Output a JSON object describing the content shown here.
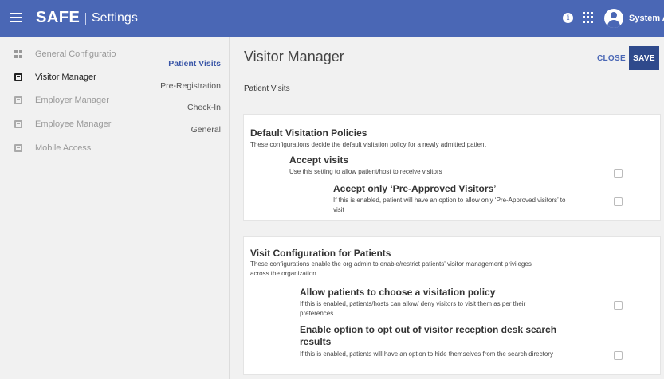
{
  "header": {
    "brand": "SAFE",
    "subtitle": "Settings",
    "user": "System A"
  },
  "sidebar": {
    "items": [
      {
        "label": "General Configuration",
        "icon": "dashboard-icon",
        "active": false
      },
      {
        "label": "Visitor Manager",
        "icon": "book-icon",
        "active": true
      },
      {
        "label": "Employer Manager",
        "icon": "book-icon",
        "active": false
      },
      {
        "label": "Employee Manager",
        "icon": "book-icon",
        "active": false
      },
      {
        "label": "Mobile Access",
        "icon": "book-icon",
        "active": false
      }
    ]
  },
  "subnav": {
    "items": [
      {
        "label": "Patient Visits",
        "active": true
      },
      {
        "label": "Pre-Registration",
        "active": false
      },
      {
        "label": "Check-In",
        "active": false
      },
      {
        "label": "General",
        "active": false
      }
    ]
  },
  "main": {
    "title": "Visitor Manager",
    "close_label": "CLOSE",
    "save_label": "SAVE",
    "section_label": "Patient Visits",
    "cards": [
      {
        "title": "Default Visitation Policies",
        "description": "These configurations decide the default visitation policy for a newly admitted patient",
        "options": [
          {
            "title": "Accept visits",
            "description": "Use this setting to allow patient/host to receive visitors",
            "checked": false
          },
          {
            "title": "Accept only ‘Pre-Approved Visitors’",
            "description": "If this is enabled, patient will have an option to allow only ‘Pre-Approved visitors’ to visit",
            "checked": false
          }
        ]
      },
      {
        "title": "Visit Configuration for Patients",
        "description": "These configurations enable the org admin to enable/restrict patients' visitor management privileges across the organization",
        "options": [
          {
            "title": "Allow patients to choose a visitation policy",
            "description": "If this is enabled, patients/hosts can allow/ deny visitors to visit them as per their preferences",
            "checked": false
          },
          {
            "title": "Enable option to opt out of visitor reception desk search results",
            "description": "If this is enabled, patients will have an option to hide themselves from the search directory",
            "checked": false
          }
        ]
      }
    ]
  }
}
